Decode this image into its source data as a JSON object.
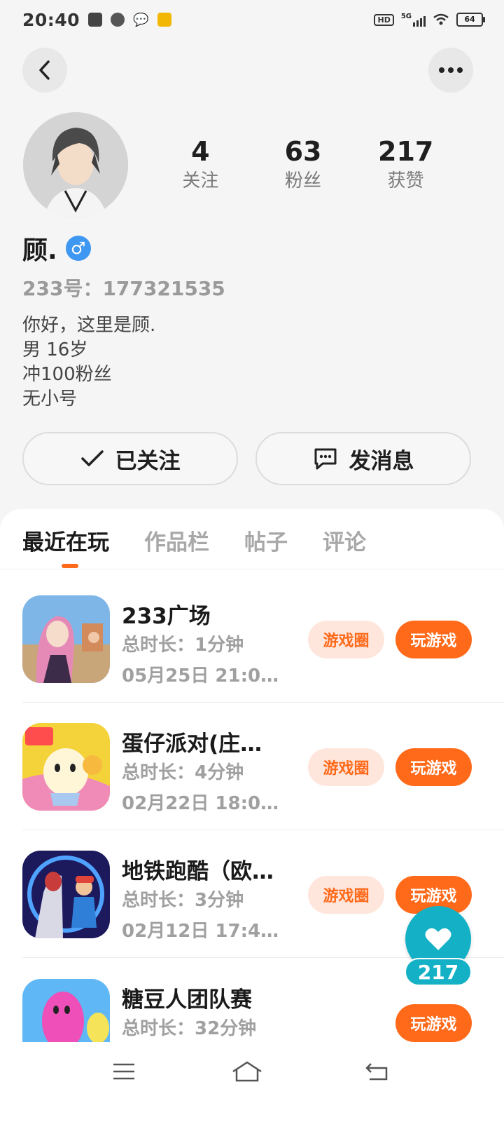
{
  "status_bar": {
    "time": "20:40",
    "hd": "HD",
    "network": "5G",
    "battery": "64"
  },
  "profile": {
    "stats": [
      {
        "value": "4",
        "label": "关注"
      },
      {
        "value": "63",
        "label": "粉丝"
      },
      {
        "value": "217",
        "label": "获赞"
      }
    ],
    "username": "顾.",
    "gender_symbol": "♂",
    "user_id": "233号：177321535",
    "bio": [
      "你好，这里是顾.",
      "男 16岁",
      "冲100粉丝",
      "无小号"
    ],
    "follow_label": "已关注",
    "message_label": "发消息"
  },
  "tabs": [
    {
      "label": "最近在玩",
      "active": true
    },
    {
      "label": "作品栏",
      "active": false
    },
    {
      "label": "帖子",
      "active": false
    },
    {
      "label": "评论",
      "active": false
    }
  ],
  "games": [
    {
      "title": "233广场",
      "playtime": "总时长：1分钟",
      "date": "05月25日 21:0…",
      "circle_label": "游戏圈",
      "play_label": "玩游戏"
    },
    {
      "title": "蛋仔派对(庄…",
      "playtime": "总时长：4分钟",
      "date": "02月22日 18:0…",
      "circle_label": "游戏圈",
      "play_label": "玩游戏"
    },
    {
      "title": "地铁跑酷（欧…",
      "playtime": "总时长：3分钟",
      "date": "02月12日 17:4…",
      "circle_label": "游戏圈",
      "play_label": "玩游戏"
    },
    {
      "title": "糖豆人团队赛",
      "playtime": "总时长：32分钟",
      "play_label": "玩游戏"
    }
  ],
  "like_fab": {
    "count": "217"
  },
  "colors": {
    "accent": "#ff6a1a",
    "accent_light": "#ffe6dc",
    "like": "#14b1c6",
    "gender": "#3e97f0"
  }
}
